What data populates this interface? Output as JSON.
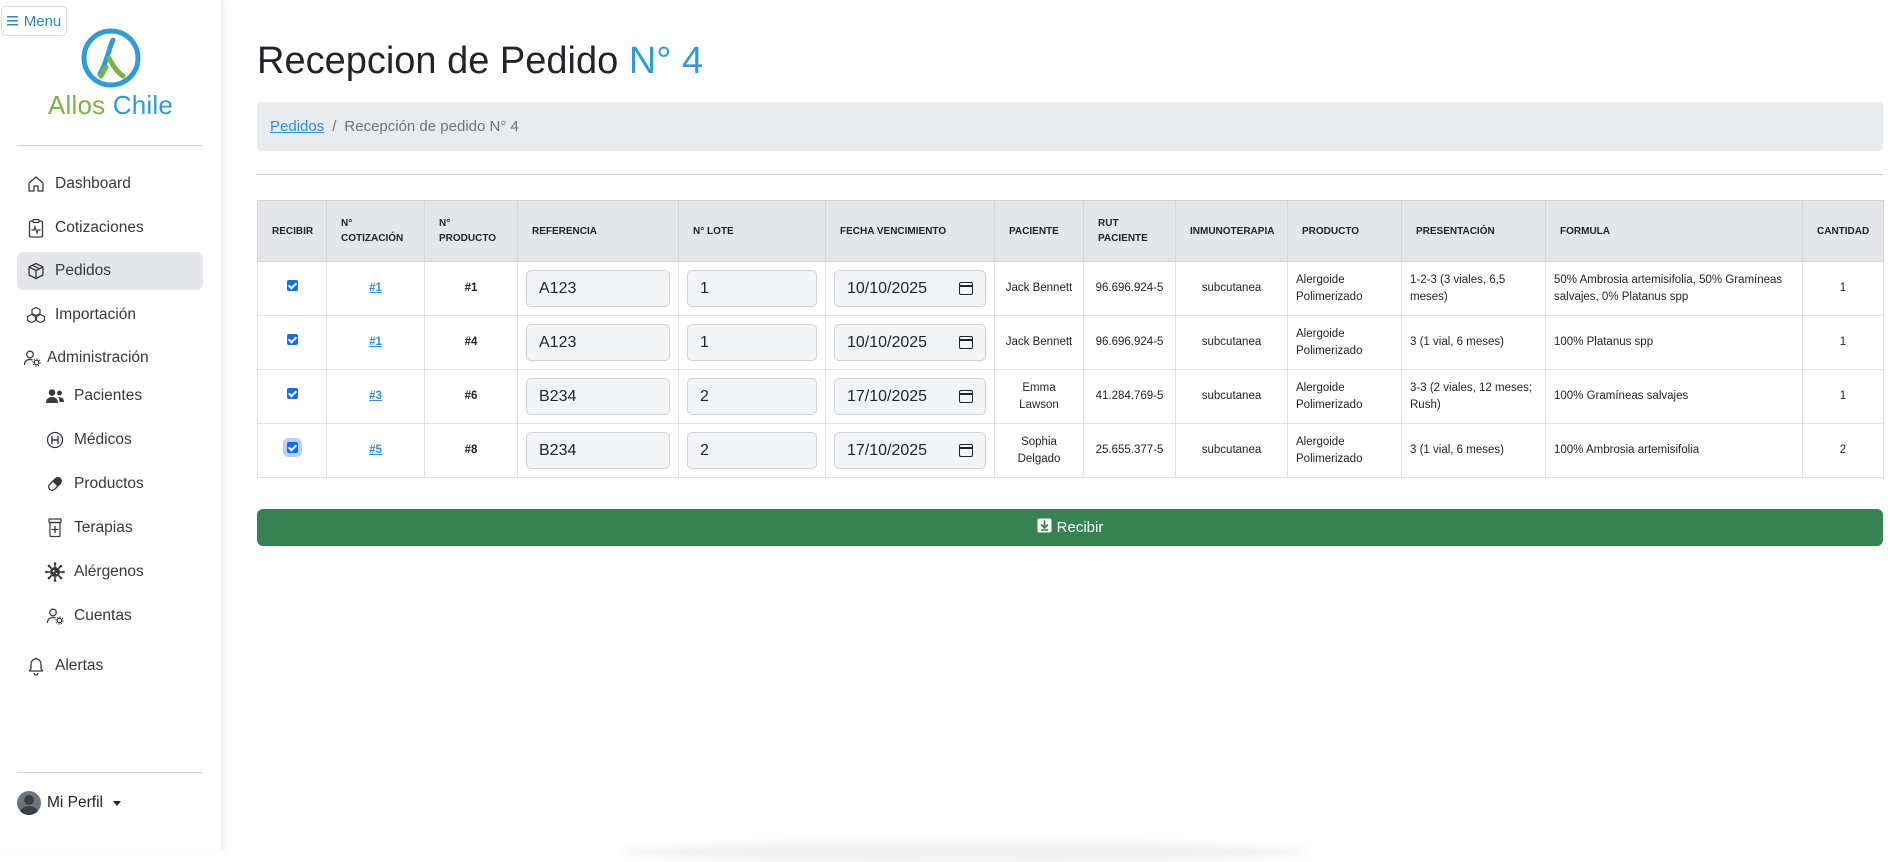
{
  "sidebar": {
    "menu_label": "Menu",
    "brand": {
      "part1": "Allos",
      "part2": "Chile"
    },
    "items": [
      {
        "label": "Dashboard",
        "icon": "home-icon"
      },
      {
        "label": "Cotizaciones",
        "icon": "clipboard-pulse-icon"
      },
      {
        "label": "Pedidos",
        "icon": "box-icon",
        "active": true
      },
      {
        "label": "Importación",
        "icon": "boxes-icon"
      },
      {
        "label": "Administración",
        "icon": "person-gear-icon"
      }
    ],
    "subitems": [
      {
        "label": "Pacientes",
        "icon": "people-icon"
      },
      {
        "label": "Médicos",
        "icon": "hospital-icon"
      },
      {
        "label": "Productos",
        "icon": "capsule-icon"
      },
      {
        "label": "Terapias",
        "icon": "prescription-icon"
      },
      {
        "label": "Alérgenos",
        "icon": "virus-icon"
      },
      {
        "label": "Cuentas",
        "icon": "person-gear-icon"
      }
    ],
    "alerts_label": "Alertas",
    "profile_label": "Mi Perfil"
  },
  "page": {
    "title_prefix": "Recepcion de Pedido ",
    "title_number": "N° 4"
  },
  "breadcrumb": {
    "parent": "Pedidos",
    "current": "Recepción de pedido N° 4"
  },
  "table": {
    "headers": [
      "RECIBIR",
      "N° COTIZACIÓN",
      "N° PRODUCTO",
      "REFERENCIA",
      "N° LOTE",
      "FECHA VENCIMIENTO",
      "PACIENTE",
      "RUT PACIENTE",
      "INMUNOTERAPIA",
      "PRODUCTO",
      "PRESENTACIÓN",
      "FORMULA",
      "CANTIDAD"
    ],
    "rows": [
      {
        "cotizacion": "#1",
        "producto_num": "#1",
        "referencia": "A123",
        "lote": "1",
        "fecha": "10/10/2025",
        "paciente": "Jack Bennett",
        "rut": "96.696.924-5",
        "inmunoterapia": "subcutanea",
        "producto": "Alergoide Polimerizado",
        "presentacion": "1-2-3 (3 viales, 6,5 meses)",
        "formula": "50% Ambrosia artemisifolia, 50% Gramíneas salvajes, 0% Platanus spp",
        "cantidad": "1"
      },
      {
        "cotizacion": "#1",
        "producto_num": "#4",
        "referencia": "A123",
        "lote": "1",
        "fecha": "10/10/2025",
        "paciente": "Jack Bennett",
        "rut": "96.696.924-5",
        "inmunoterapia": "subcutanea",
        "producto": "Alergoide Polimerizado",
        "presentacion": "3 (1 vial, 6 meses)",
        "formula": "100% Platanus spp",
        "cantidad": "1"
      },
      {
        "cotizacion": "#3",
        "producto_num": "#6",
        "referencia": "B234",
        "lote": "2",
        "fecha": "17/10/2025",
        "paciente": "Emma Lawson",
        "rut": "41.284.769-5",
        "inmunoterapia": "subcutanea",
        "producto": "Alergoide Polimerizado",
        "presentacion": "3-3 (2 viales, 12 meses; Rush)",
        "formula": "100% Gramíneas salvajes",
        "cantidad": "1"
      },
      {
        "cotizacion": "#5",
        "producto_num": "#8",
        "referencia": "B234",
        "lote": "2",
        "fecha": "17/10/2025",
        "paciente": "Sophia Delgado",
        "rut": "25.655.377-5",
        "inmunoterapia": "subcutanea",
        "producto": "Alergoide Polimerizado",
        "presentacion": "3 (1 vial, 6 meses)",
        "formula": "100% Ambrosia artemisifolia",
        "cantidad": "2"
      }
    ]
  },
  "actions": {
    "receive_label": "Recibir"
  },
  "colors": {
    "accent": "#2d9cdb",
    "brand_green": "#7cb342",
    "button_green": "#378253"
  }
}
